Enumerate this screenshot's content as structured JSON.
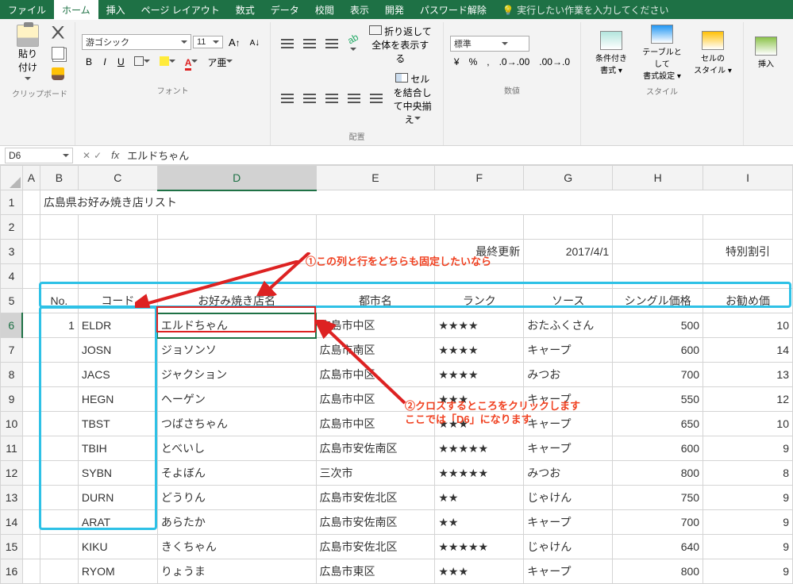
{
  "tabs": {
    "file": "ファイル",
    "home": "ホーム",
    "insert": "挿入",
    "pagelayout": "ページ レイアウト",
    "formulas": "数式",
    "data": "データ",
    "review": "校閲",
    "view": "表示",
    "developer": "開発",
    "password": "パスワード解除",
    "tellme": "実行したい作業を入力してください"
  },
  "ribbon": {
    "clipboard_label": "クリップボード",
    "paste": "貼り付け",
    "font_label": "フォント",
    "font_name": "游ゴシック",
    "font_size": "11",
    "align_label": "配置",
    "wrap_text": "折り返して全体を表示する",
    "merge": "セルを結合して中央揃え",
    "number_label": "数値",
    "number_format": "標準",
    "style_label": "スタイル",
    "cond_fmt1": "条件付き",
    "cond_fmt2": "書式 ▾",
    "table_fmt1": "テーブルとして",
    "table_fmt2": "書式設定 ▾",
    "cell_style1": "セルの",
    "cell_style2": "スタイル ▾",
    "insert_cell": "挿入",
    "b": "B",
    "i": "I",
    "u": "U",
    "a_big": "A",
    "a_small": "A"
  },
  "fxbar": {
    "name": "D6",
    "x": "✕",
    "check": "✓",
    "fx": "fx",
    "value": "エルドちゃん"
  },
  "cols": [
    "A",
    "B",
    "C",
    "D",
    "E",
    "F",
    "G",
    "H",
    "I"
  ],
  "rowlabels": [
    "1",
    "2",
    "3",
    "4",
    "5",
    "6",
    "7",
    "8",
    "9",
    "10",
    "11",
    "12",
    "13",
    "14",
    "15",
    "16"
  ],
  "content": {
    "title": "広島県お好み焼き店リスト",
    "update_label": "最終更新",
    "update_date": "2017/4/1",
    "special": "特別割引",
    "headers": {
      "no": "No.",
      "code": "コード",
      "shop": "お好み焼き店名",
      "city": "都市名",
      "rank": "ランク",
      "sauce": "ソース",
      "single": "シングル価格",
      "reco": "お勧め価"
    },
    "rows": [
      {
        "no": "1",
        "code": "ELDR",
        "shop": "エルドちゃん",
        "city": "広島市中区",
        "rank": "★★★★",
        "sauce": "おたふくさん",
        "single": "500",
        "reco": "10"
      },
      {
        "no": "",
        "code": "JOSN",
        "shop": "ジョソンソ",
        "city": "広島市南区",
        "rank": "★★★★",
        "sauce": "キャープ",
        "single": "600",
        "reco": "14"
      },
      {
        "no": "",
        "code": "JACS",
        "shop": "ジャクション",
        "city": "広島市中区",
        "rank": "★★★★",
        "sauce": "みつお",
        "single": "700",
        "reco": "13"
      },
      {
        "no": "",
        "code": "HEGN",
        "shop": "ヘーゲン",
        "city": "広島市中区",
        "rank": "★★★",
        "sauce": "キャープ",
        "single": "550",
        "reco": "12"
      },
      {
        "no": "",
        "code": "TBST",
        "shop": "つばさちゃん",
        "city": "広島市中区",
        "rank": "★★★",
        "sauce": "キャープ",
        "single": "650",
        "reco": "10"
      },
      {
        "no": "",
        "code": "TBIH",
        "shop": "とべいし",
        "city": "広島市安佐南区",
        "rank": "★★★★★",
        "sauce": "キャープ",
        "single": "600",
        "reco": "9"
      },
      {
        "no": "",
        "code": "SYBN",
        "shop": "そよぼん",
        "city": "三次市",
        "rank": "★★★★★",
        "sauce": "みつお",
        "single": "800",
        "reco": "8"
      },
      {
        "no": "",
        "code": "DURN",
        "shop": "どうりん",
        "city": "広島市安佐北区",
        "rank": "★★",
        "sauce": "じゃけん",
        "single": "750",
        "reco": "9"
      },
      {
        "no": "",
        "code": "ARAT",
        "shop": "あらたか",
        "city": "広島市安佐南区",
        "rank": "★★",
        "sauce": "キャープ",
        "single": "700",
        "reco": "9"
      },
      {
        "no": "",
        "code": "KIKU",
        "shop": "きくちゃん",
        "city": "広島市安佐北区",
        "rank": "★★★★★",
        "sauce": "じゃけん",
        "single": "640",
        "reco": "9"
      },
      {
        "no": "",
        "code": "RYOM",
        "shop": "りょうま",
        "city": "広島市東区",
        "rank": "★★★",
        "sauce": "キャープ",
        "single": "800",
        "reco": "9"
      }
    ]
  },
  "annotations": {
    "line1": "①この列と行をどちらも固定したいなら",
    "line2a": "②クロスするところをクリックします",
    "line2b": "ここでは「D6」になります"
  }
}
